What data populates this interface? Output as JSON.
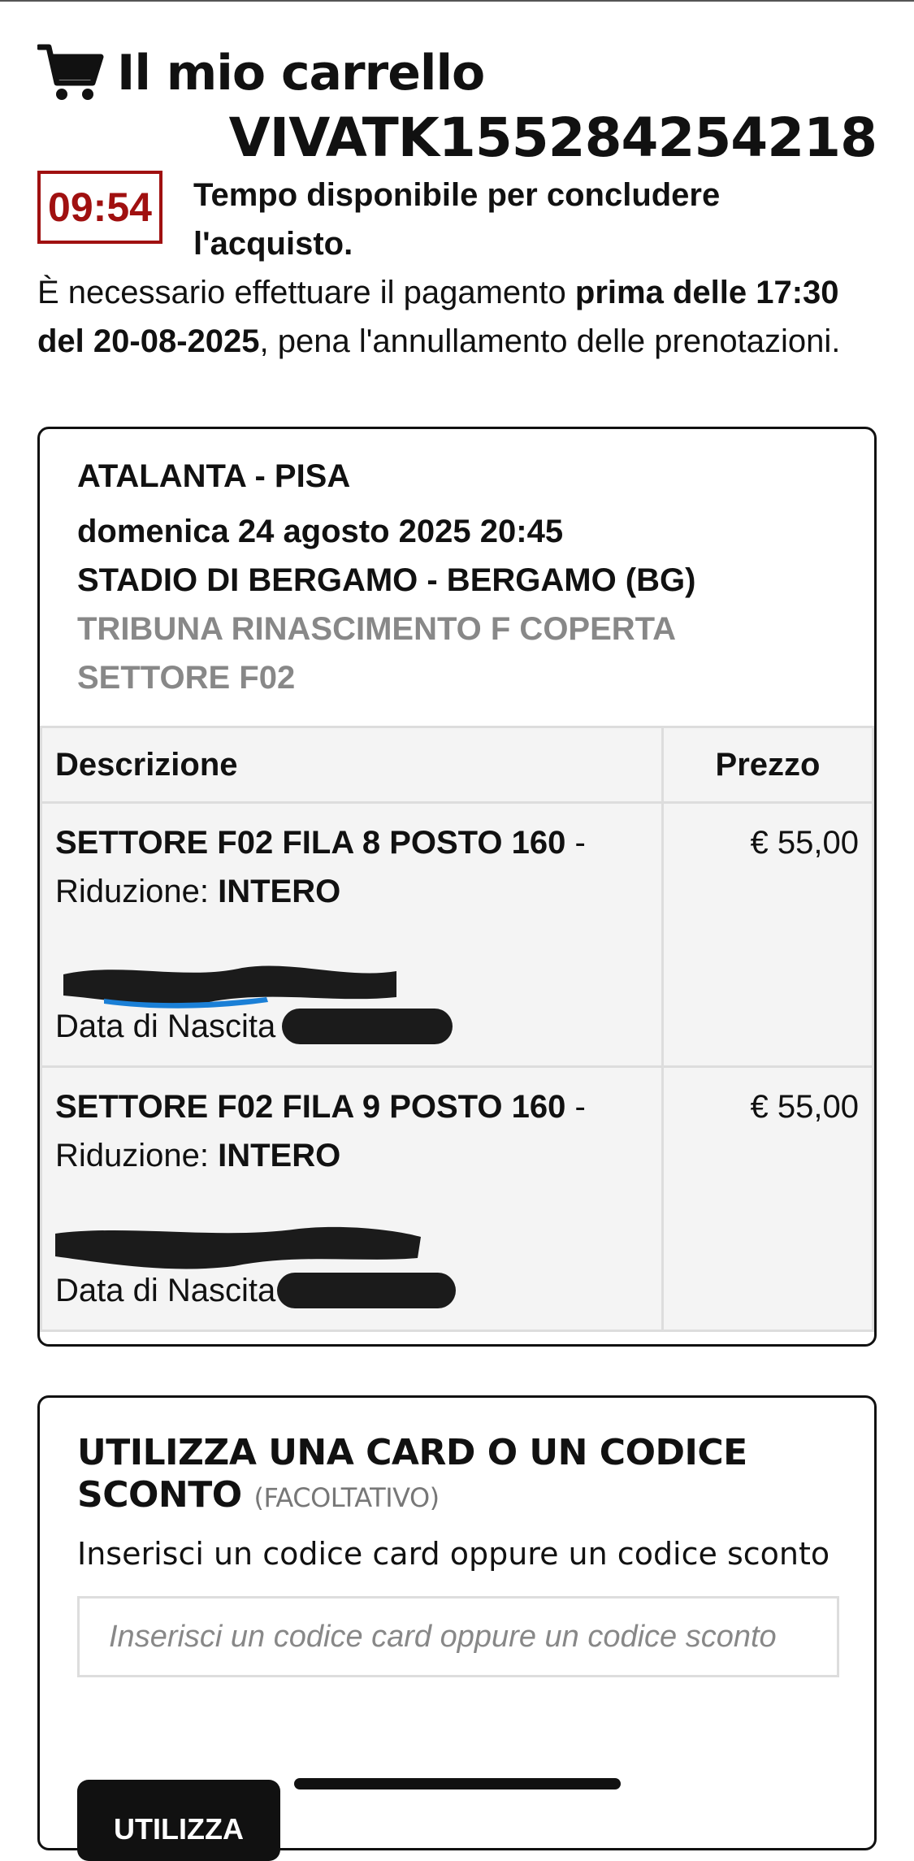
{
  "header": {
    "title": "Il mio carrello",
    "order_code": "VIVATK155284254218"
  },
  "timer": {
    "value": "09:54",
    "label": "Tempo disponibile per concludere l'acquisto."
  },
  "payment_note": {
    "prefix": "È necessario effettuare il pagamento ",
    "deadline": "prima delle 17:30 del 20-08-2025",
    "suffix": ", pena l'annullamento delle prenotazioni."
  },
  "event": {
    "match": "ATALANTA - PISA",
    "datetime": "domenica 24 agosto 2025 20:45",
    "venue": "STADIO DI BERGAMO - BERGAMO (BG)",
    "stand": "TRIBUNA RINASCIMENTO F COPERTA",
    "sector": "SETTORE F02"
  },
  "table": {
    "col_description": "Descrizione",
    "col_price": "Prezzo",
    "rows": [
      {
        "seat": "SETTORE F02 FILA 8 POSTO 160",
        "separator": " -",
        "reduction_label": "Riduzione: ",
        "reduction_value": "INTERO",
        "birth_label": "Data di Nascita",
        "price": "€ 55,00"
      },
      {
        "seat": "SETTORE F02 FILA 9 POSTO 160",
        "separator": " -",
        "reduction_label": "Riduzione: ",
        "reduction_value": "INTERO",
        "birth_label": "Data di Nascita",
        "price": "€ 55,00"
      }
    ]
  },
  "discount": {
    "title": "UTILIZZA UNA CARD O UN CODICE SCONTO",
    "optional": "(FACOLTATIVO)",
    "hint": "Inserisci un codice card oppure un codice sconto",
    "placeholder": "Inserisci un codice card oppure un codice sconto",
    "value": "",
    "button_label": "UTILIZZA"
  },
  "colors": {
    "timer_red": "#a01010",
    "redaction": "#1b1b1b",
    "redaction_accent": "#1a7fd6"
  }
}
